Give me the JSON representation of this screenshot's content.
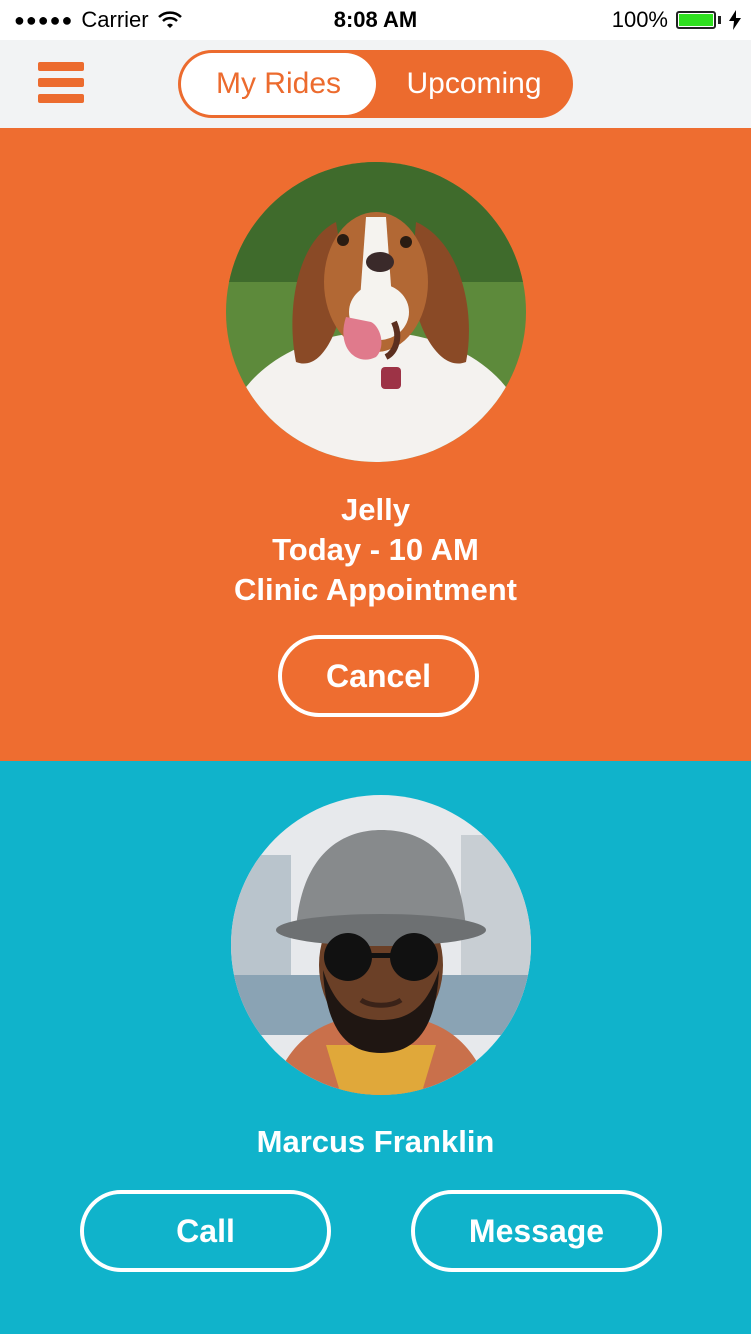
{
  "status_bar": {
    "carrier": "Carrier",
    "time": "8:08 AM",
    "battery_text": "100%",
    "signal_dots": "●●●●●",
    "battery_level": 1.0
  },
  "nav": {
    "menu_icon": "hamburger-menu-icon",
    "tabs": [
      {
        "label": "My Rides",
        "selected": true
      },
      {
        "label": "Upcoming",
        "selected": false
      }
    ]
  },
  "ride": {
    "pet_name": "Jelly",
    "when": "Today - 10 AM",
    "purpose": "Clinic Appointment",
    "cancel_label": "Cancel",
    "avatar": "dog-photo"
  },
  "driver": {
    "name": "Marcus Franklin",
    "call_label": "Call",
    "message_label": "Message",
    "avatar": "driver-photo"
  },
  "colors": {
    "accent_orange": "#ec6b2e",
    "teal": "#10b3cb",
    "white": "#ffffff"
  }
}
